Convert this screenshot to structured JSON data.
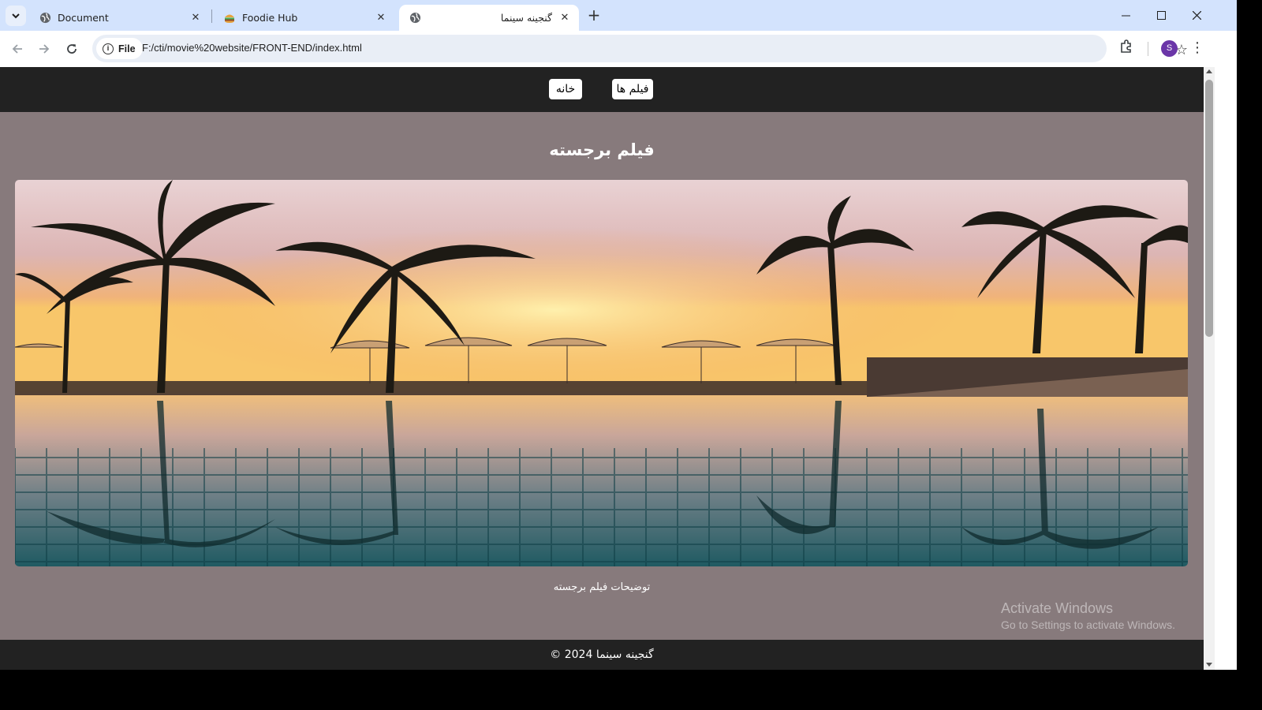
{
  "browser": {
    "tabs": [
      {
        "title": "Document",
        "icon": "globe-icon"
      },
      {
        "title": "Foodie Hub",
        "icon": "burger-icon"
      },
      {
        "title": "گنجینه سینما",
        "icon": "globe-icon",
        "active": true
      }
    ],
    "address": {
      "chip_label": "File",
      "url": "F:/cti/movie%20website/FRONT-END/index.html"
    },
    "profile_initial": "S"
  },
  "page": {
    "nav": {
      "home_label": "خانه",
      "movies_label": "فیلم ها"
    },
    "featured": {
      "title": "فیلم برجسته",
      "image": "tropical-pool-sunset-photo",
      "description": "توضیحات فیلم برجسته"
    },
    "footer": {
      "text": "گنجینه سینما 2024 ©"
    }
  },
  "overlay": {
    "activation_title": "Activate Windows",
    "activation_sub": "Go to Settings to activate Windows."
  },
  "colors": {
    "tabstrip": "#d3e3fd",
    "page_bg": "#877a7c",
    "nav_bg": "#222222",
    "avatar": "#6b36a8"
  }
}
